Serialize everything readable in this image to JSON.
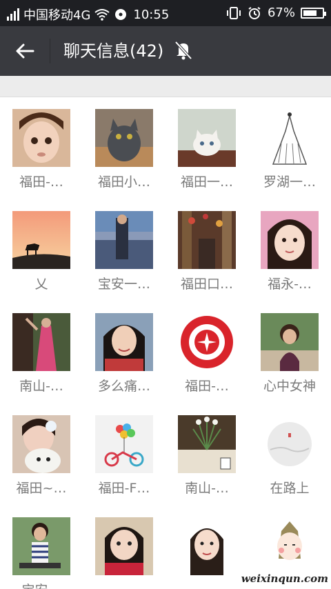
{
  "status_bar": {
    "carrier": "中国移动4G",
    "time": "10:55",
    "battery": "67%",
    "battery_fraction": 0.67
  },
  "header": {
    "title": "聊天信息(42)"
  },
  "members": [
    {
      "name": "福田-…",
      "avatar": "girl-portrait"
    },
    {
      "name": "福田小…",
      "avatar": "gray-cat"
    },
    {
      "name": "福田一…",
      "avatar": "white-kitten"
    },
    {
      "name": "罗湖一…",
      "avatar": "dress-sketch"
    },
    {
      "name": "乂",
      "avatar": "horse-sunset"
    },
    {
      "name": "宝安一…",
      "avatar": "harbor-person"
    },
    {
      "name": "福田口…",
      "avatar": "market-street"
    },
    {
      "name": "福永-…",
      "avatar": "woman-selfie"
    },
    {
      "name": "南山-…",
      "avatar": "woman-pink-dress"
    },
    {
      "name": "多么痛…",
      "avatar": "woman-smile"
    },
    {
      "name": "福田-…",
      "avatar": "hong-kong-emblem"
    },
    {
      "name": "心中女神",
      "avatar": "child-outdoors"
    },
    {
      "name": "福田~…",
      "avatar": "girl-with-dog"
    },
    {
      "name": "福田-F…",
      "avatar": "bicycle-balloons"
    },
    {
      "name": "南山-…",
      "avatar": "restaurant-flowers"
    },
    {
      "name": "在路上",
      "avatar": "minimal-landscape"
    },
    {
      "name": "宝安…",
      "avatar": "boy-stroller"
    },
    {
      "name": "",
      "avatar": "girl-red-shirt"
    },
    {
      "name": "",
      "avatar": "woman-white-bg"
    },
    {
      "name": "",
      "avatar": "cartoon-girl"
    }
  ],
  "watermark": "weixinqun.com"
}
